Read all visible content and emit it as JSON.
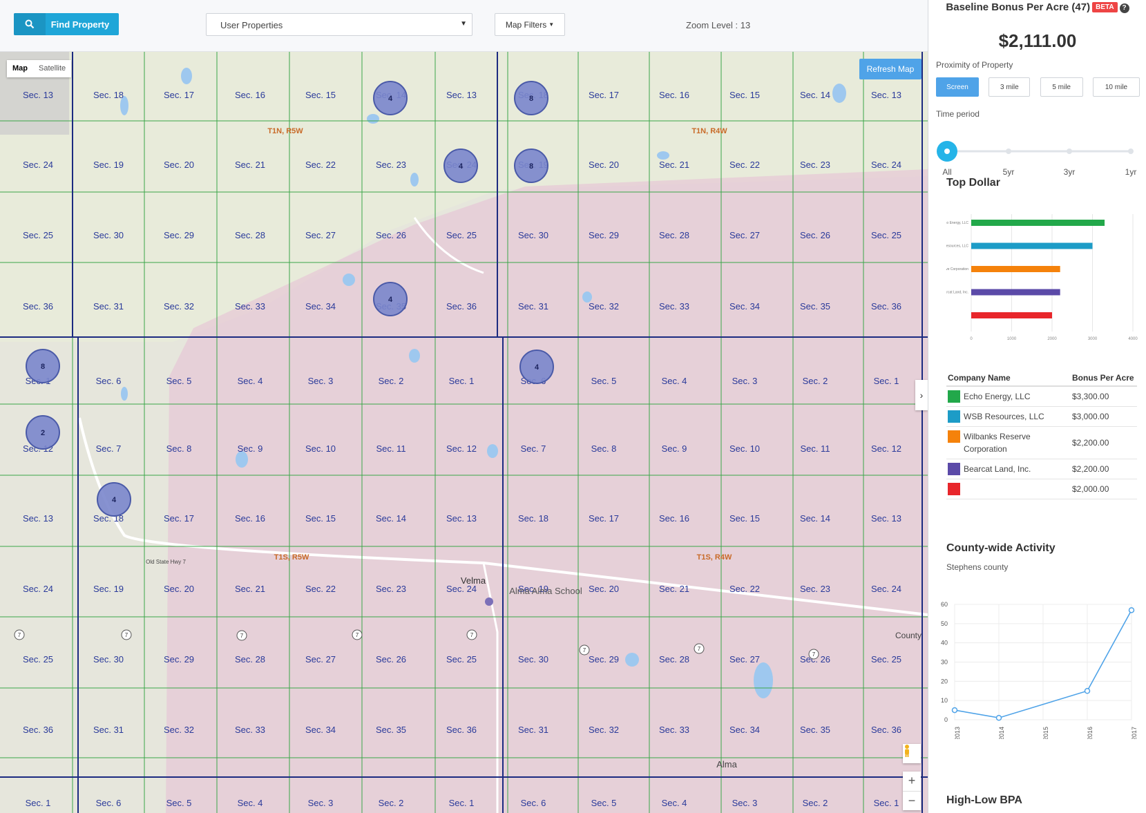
{
  "toolbar": {
    "find_label": "Find Property",
    "select_value": "User Properties",
    "filters_label": "Map Filters",
    "zoom_text": "Zoom Level : 13"
  },
  "map": {
    "toggle_map": "Map",
    "toggle_satellite": "Satellite",
    "refresh_label": "Refresh Map",
    "township_labels": [
      "T1N, R5W",
      "T1N, R4W",
      "T1S, R5W",
      "T1S, R4W"
    ],
    "sections": [
      [
        "Sec. 13",
        "Sec. 18",
        "Sec. 17",
        "Sec. 16",
        "Sec. 15",
        "Sec. 14",
        "Sec. 13",
        "Sec. 18",
        "Sec. 17",
        "Sec. 16",
        "Sec. 15",
        "Sec. 14",
        "Sec. 13"
      ],
      [
        "Sec. 24",
        "Sec. 19",
        "Sec. 20",
        "Sec. 21",
        "Sec. 22",
        "Sec. 23",
        "Sec. 24",
        "Sec. 19",
        "Sec. 20",
        "Sec. 21",
        "Sec. 22",
        "Sec. 23",
        "Sec. 24"
      ],
      [
        "Sec. 25",
        "Sec. 30",
        "Sec. 29",
        "Sec. 28",
        "Sec. 27",
        "Sec. 26",
        "Sec. 25",
        "Sec. 30",
        "Sec. 29",
        "Sec. 28",
        "Sec. 27",
        "Sec. 26",
        "Sec. 25"
      ],
      [
        "Sec. 36",
        "Sec. 31",
        "Sec. 32",
        "Sec. 33",
        "Sec. 34",
        "Sec. 35",
        "Sec. 36",
        "Sec. 31",
        "Sec. 32",
        "Sec. 33",
        "Sec. 34",
        "Sec. 35",
        "Sec. 36"
      ],
      [
        "Sec. 1",
        "Sec. 6",
        "Sec. 5",
        "Sec. 4",
        "Sec. 3",
        "Sec. 2",
        "Sec. 1",
        "Sec. 6",
        "Sec. 5",
        "Sec. 4",
        "Sec. 3",
        "Sec. 2",
        "Sec. 1"
      ],
      [
        "Sec. 12",
        "Sec. 7",
        "Sec. 8",
        "Sec. 9",
        "Sec. 10",
        "Sec. 11",
        "Sec. 12",
        "Sec. 7",
        "Sec. 8",
        "Sec. 9",
        "Sec. 10",
        "Sec. 11",
        "Sec. 12"
      ],
      [
        "Sec. 13",
        "Sec. 18",
        "Sec. 17",
        "Sec. 16",
        "Sec. 15",
        "Sec. 14",
        "Sec. 13",
        "Sec. 18",
        "Sec. 17",
        "Sec. 16",
        "Sec. 15",
        "Sec. 14",
        "Sec. 13"
      ],
      [
        "Sec. 24",
        "Sec. 19",
        "Sec. 20",
        "Sec. 21",
        "Sec. 22",
        "Sec. 23",
        "Sec. 24",
        "Sec. 19",
        "Sec. 20",
        "Sec. 21",
        "Sec. 22",
        "Sec. 23",
        "Sec. 24"
      ],
      [
        "Sec. 25",
        "Sec. 30",
        "Sec. 29",
        "Sec. 28",
        "Sec. 27",
        "Sec. 26",
        "Sec. 25",
        "Sec. 30",
        "Sec. 29",
        "Sec. 28",
        "Sec. 27",
        "Sec. 26",
        "Sec. 25"
      ],
      [
        "Sec. 36",
        "Sec. 31",
        "Sec. 32",
        "Sec. 33",
        "Sec. 34",
        "Sec. 35",
        "Sec. 36",
        "Sec. 31",
        "Sec. 32",
        "Sec. 33",
        "Sec. 34",
        "Sec. 35",
        "Sec. 36"
      ],
      [
        "Sec. 1",
        "Sec. 6",
        "Sec. 5",
        "Sec. 4",
        "Sec. 3",
        "Sec. 2",
        "Sec. 1",
        "Sec. 6",
        "Sec. 5",
        "Sec. 4",
        "Sec. 3",
        "Sec. 2",
        "Sec. 1"
      ]
    ],
    "clusters": [
      "4",
      "8",
      "4",
      "8",
      "4",
      "8",
      "4",
      "2",
      "4"
    ],
    "place_labels": [
      "Velma",
      "Alma Alma School",
      "Alma",
      "Old State Hwy 7",
      "County"
    ]
  },
  "sidebar": {
    "title": "Baseline Bonus Per Acre (47)",
    "beta": "BETA",
    "help": "?",
    "price": "$2,111.00",
    "proximity_label": "Proximity of Property",
    "proximity_options": [
      "Screen",
      "3 mile",
      "5 mile",
      "10 mile"
    ],
    "time_label": "Time period",
    "time_options": [
      "All",
      "5yr",
      "3yr",
      "1yr"
    ],
    "top_dollar_title": "Top Dollar",
    "table_headers": [
      "Company Name",
      "Bonus Per Acre"
    ],
    "table_rows": [
      {
        "name": "Echo Energy, LLC",
        "amount": "$3,300.00",
        "color": "#22a84a"
      },
      {
        "name": "WSB Resources, LLC",
        "amount": "$3,000.00",
        "color": "#1d9cc7"
      },
      {
        "name": "Wilbanks Reserve Corporation",
        "amount": "$2,200.00",
        "color": "#f5820b"
      },
      {
        "name": "Bearcat Land, Inc.",
        "amount": "$2,200.00",
        "color": "#5b4aa8"
      },
      {
        "name": "",
        "amount": "$2,000.00",
        "color": "#e8262b"
      }
    ],
    "county_title": "County-wide Activity",
    "county_sub": "Stephens county",
    "high_low_title": "High-Low BPA"
  },
  "chart_data": [
    {
      "type": "bar",
      "orientation": "horizontal",
      "categories": [
        "Echo Energy, LLC",
        "WSB Resources, LLC",
        "Wilbanks Reserve Corporation",
        "Bearcat Land, Inc.",
        ""
      ],
      "values": [
        3300,
        3000,
        2200,
        2200,
        2000
      ],
      "colors": [
        "#22a84a",
        "#1d9cc7",
        "#f5820b",
        "#5b4aa8",
        "#e8262b"
      ],
      "xlim": [
        0,
        4000
      ],
      "xticks": [
        "0",
        "1000",
        "2000",
        "3000",
        "4000"
      ],
      "grid": true
    },
    {
      "type": "line",
      "x": [
        "2013",
        "2014",
        "2015",
        "2016",
        "2017"
      ],
      "points": [
        {
          "x": 2013,
          "y": 5
        },
        {
          "x": 2014,
          "y": 1
        },
        {
          "x": 2016,
          "y": 15
        },
        {
          "x": 2017,
          "y": 57
        }
      ],
      "ylim": [
        0,
        60
      ],
      "yticks": [
        "0",
        "10",
        "20",
        "30",
        "40",
        "50",
        "60"
      ],
      "color": "#4fa3e8",
      "grid": true
    }
  ]
}
